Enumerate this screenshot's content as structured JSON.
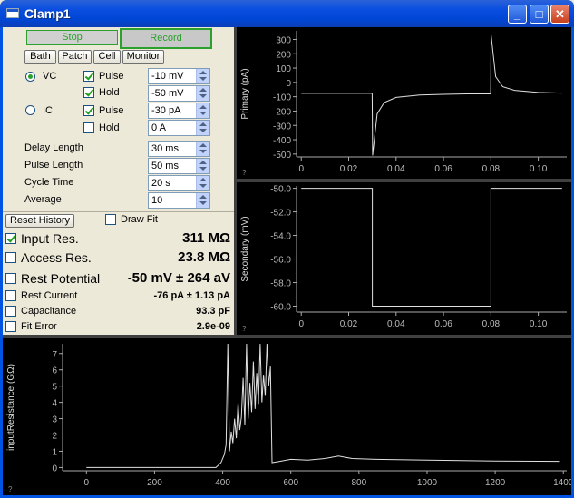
{
  "window": {
    "title": "Clamp1"
  },
  "controls": {
    "stop_label": "Stop",
    "record_label": "Record",
    "tabs": [
      "Bath",
      "Patch",
      "Cell",
      "Monitor"
    ],
    "vc_label": "VC",
    "ic_label": "IC",
    "vc_pulse_label": "Pulse",
    "vc_pulse_value": "-10 mV",
    "vc_hold_label": "Hold",
    "vc_hold_value": "-50 mV",
    "ic_pulse_label": "Pulse",
    "ic_pulse_value": "-30 pA",
    "ic_hold_label": "Hold",
    "ic_hold_value": "0 A",
    "delay_length_label": "Delay Length",
    "delay_length_value": "30 ms",
    "pulse_length_label": "Pulse Length",
    "pulse_length_value": "50 ms",
    "cycle_time_label": "Cycle Time",
    "cycle_time_value": "20 s",
    "average_label": "Average",
    "average_value": "10",
    "reset_history_label": "Reset History",
    "draw_fit_label": "Draw Fit"
  },
  "results": {
    "input_res_label": "Input Res.",
    "input_res_value": "311 MΩ",
    "access_res_label": "Access Res.",
    "access_res_value": "23.8 MΩ",
    "rest_potential_label": "Rest Potential",
    "rest_potential_value": "-50 mV ± 264 aV",
    "rest_current_label": "Rest Current",
    "rest_current_value": "-76 pA ± 1.13 pA",
    "capacitance_label": "Capacitance",
    "capacitance_value": "93.3 pF",
    "fit_error_label": "Fit Error",
    "fit_error_value": "2.9e-09"
  },
  "chart_data": [
    {
      "type": "line",
      "ylabel": "Primary (pA)",
      "xlim": [
        -0.002,
        0.112
      ],
      "ylim": [
        -520,
        360
      ],
      "x_ticks": [
        "0",
        "0.02",
        "0.04",
        "0.06",
        "0.08",
        "0.10"
      ],
      "y_ticks": [
        "300",
        "200",
        "100",
        "0",
        "-100",
        "-200",
        "-300",
        "-400",
        "-500"
      ],
      "corner_mark": "?",
      "series": [
        {
          "x": [
            0,
            0.0299,
            0.0301,
            0.032,
            0.035,
            0.04,
            0.05,
            0.06,
            0.07,
            0.0799,
            0.0801,
            0.082,
            0.085,
            0.09,
            0.1,
            0.11
          ],
          "values": [
            -76,
            -76,
            -510,
            -220,
            -140,
            -105,
            -88,
            -83,
            -80,
            -80,
            330,
            40,
            -30,
            -55,
            -70,
            -74
          ]
        }
      ]
    },
    {
      "type": "line",
      "ylabel": "Secondary (mV)",
      "xlim": [
        -0.002,
        0.112
      ],
      "ylim": [
        -60.5,
        -49.8
      ],
      "x_ticks": [
        "0",
        "0.02",
        "0.04",
        "0.06",
        "0.08",
        "0.10"
      ],
      "y_ticks": [
        "-50.0",
        "-52.0",
        "-54.0",
        "-56.0",
        "-58.0",
        "-60.0"
      ],
      "corner_mark": "?",
      "series": [
        {
          "x": [
            0,
            0.03,
            0.03,
            0.08,
            0.08,
            0.11
          ],
          "values": [
            -50,
            -50,
            -60,
            -60,
            -50,
            -50
          ]
        }
      ]
    },
    {
      "type": "line",
      "ylabel": "inputResistance (GΩ)",
      "xlim": [
        -70,
        1410
      ],
      "ylim": [
        -0.2,
        7.6
      ],
      "x_ticks": [
        "0",
        "200",
        "400",
        "600",
        "800",
        "1000",
        "1200",
        "1400"
      ],
      "y_ticks": [
        "7",
        "6",
        "5",
        "4",
        "3",
        "2",
        "1",
        "0"
      ],
      "corner_mark": "?",
      "series": [
        {
          "x": [
            0,
            380,
            395,
            405,
            410,
            415,
            420,
            425,
            430,
            435,
            440,
            445,
            450,
            455,
            460,
            465,
            470,
            475,
            480,
            485,
            490,
            495,
            500,
            505,
            510,
            515,
            520,
            525,
            530,
            535,
            540,
            545,
            560,
            600,
            650,
            700,
            740,
            780,
            850,
            1000,
            1200,
            1390
          ],
          "values": [
            0,
            0,
            0.3,
            0.8,
            1.4,
            7.6,
            1.0,
            2.2,
            1.5,
            3.0,
            1.8,
            4.0,
            2.3,
            3.1,
            5.5,
            2.6,
            7.6,
            3.0,
            5.2,
            3.4,
            6.5,
            3.6,
            5.8,
            3.9,
            7.6,
            4.0,
            5.7,
            4.4,
            7.6,
            5.0,
            6.2,
            0.3,
            0.35,
            0.5,
            0.45,
            0.55,
            0.7,
            0.55,
            0.5,
            0.45,
            0.4,
            0.38
          ]
        }
      ]
    }
  ]
}
